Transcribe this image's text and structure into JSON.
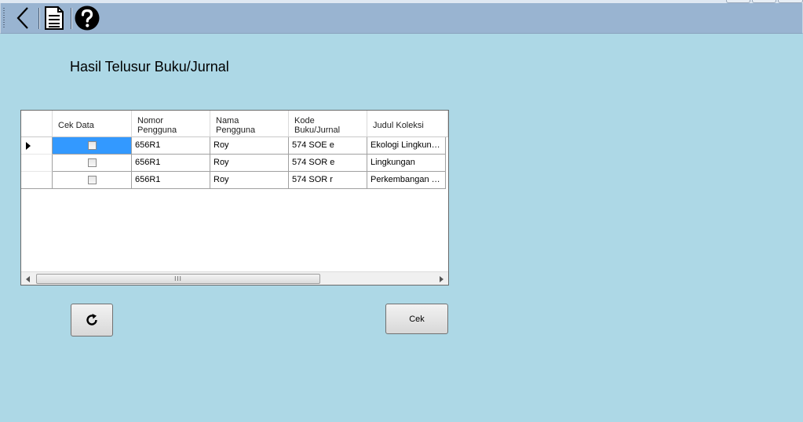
{
  "toolbar": {
    "back_icon": "chevron-left-icon",
    "report_icon": "document-icon",
    "help_icon": "help-icon"
  },
  "page": {
    "title": "Hasil Telusur Buku/Jurnal"
  },
  "table": {
    "columns": [
      {
        "label": "Cek Data"
      },
      {
        "label": "Nomor\nPengguna"
      },
      {
        "label": "Nama\nPengguna"
      },
      {
        "label": "Kode\nBuku/Jurnal"
      },
      {
        "label": "Judul Koleksi"
      }
    ],
    "rows": [
      {
        "nomor": "656R1",
        "nama": "Roy",
        "kode": "574 SOE e",
        "judul": "Ekologi Lingkungan",
        "checked": false
      },
      {
        "nomor": "656R1",
        "nama": "Roy",
        "kode": "574 SOR e",
        "judul": "Lingkungan",
        "checked": false
      },
      {
        "nomor": "656R1",
        "nama": "Roy",
        "kode": "574 SOR r",
        "judul": "Perkembangan Kota",
        "checked": false
      }
    ],
    "scroll_thumb_label": "III"
  },
  "buttons": {
    "refresh_icon": "refresh-icon",
    "cek_label": "Cek"
  },
  "colors": {
    "background": "#add8e6",
    "toolbar": "#99b4d1",
    "selection": "#3399ff"
  }
}
